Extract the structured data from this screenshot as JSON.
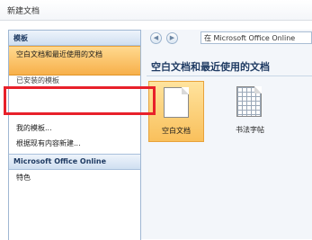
{
  "window": {
    "title": "新建文档"
  },
  "left_pane": {
    "header": "模板",
    "items": [
      {
        "label": "空白文档和最近使用的文档",
        "selected": true
      },
      {
        "label": "已安装的模板"
      },
      {
        "label": "我的模板..."
      },
      {
        "label": "根据现有内容新建..."
      }
    ],
    "section": "Microsoft Office Online",
    "section_items": [
      {
        "label": "特色"
      }
    ]
  },
  "right_pane": {
    "back_glyph": "◀",
    "forward_glyph": "▶",
    "address": "在 Microsoft Office Online",
    "category_title": "空白文档和最近使用的文档",
    "tiles": [
      {
        "label": "空白文档",
        "icon": "blank-document-icon",
        "selected": true
      },
      {
        "label": "书法字帖",
        "icon": "calligraphy-grid-icon"
      }
    ]
  },
  "colors": {
    "selection": "#f7b04a",
    "highlight_box": "#e8202a",
    "header_blue": "#1f3b63"
  }
}
